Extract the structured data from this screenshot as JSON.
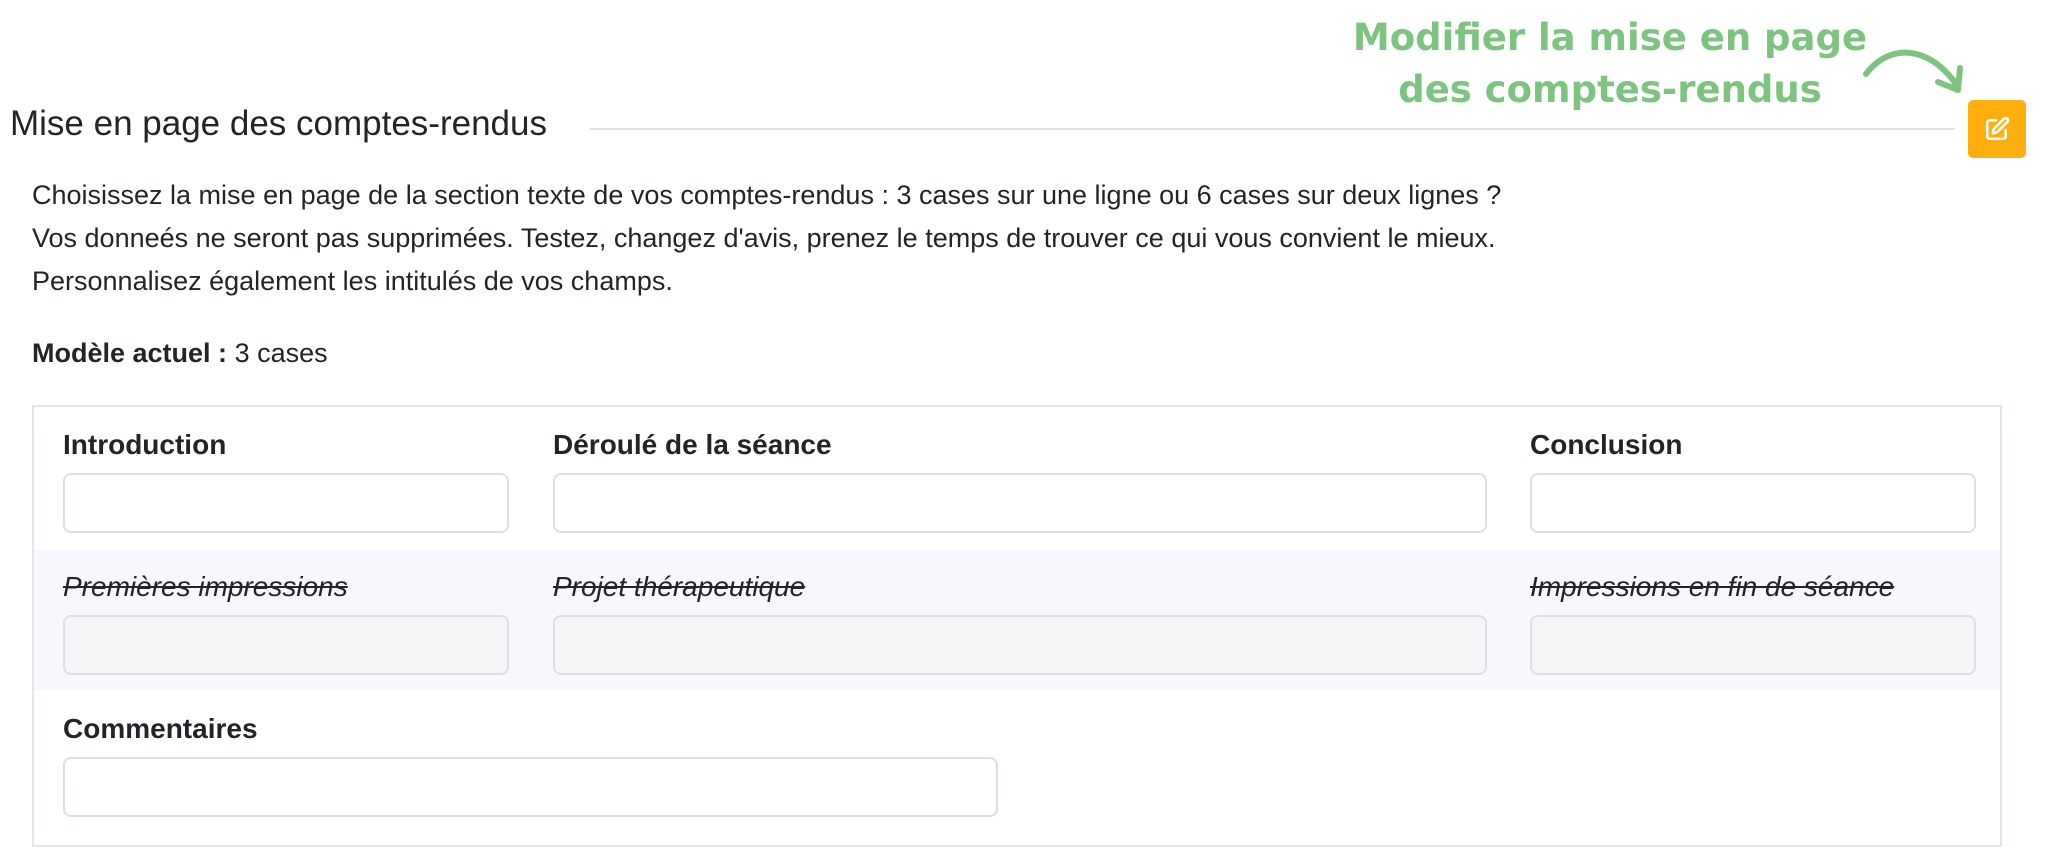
{
  "callout": {
    "line1": "Modifier la mise en page",
    "line2": "des comptes-rendus",
    "color": "#7cc47f"
  },
  "section": {
    "title": "Mise en page des comptes-rendus",
    "edit_icon": "edit-icon",
    "edit_button_color": "#ffae0d"
  },
  "description": {
    "line1": "Choisissez la mise en page de la section texte de vos comptes-rendus : 3 cases sur une ligne ou 6 cases sur deux lignes ?",
    "line2": "Vos donneés ne seront pas supprimées. Testez, changez d'avis, prenez le temps de trouver ce qui vous convient le mieux.",
    "line3": "Personnalisez également les intitulés de vos champs."
  },
  "current_model": {
    "label": "Modèle actuel :",
    "value": "3 cases"
  },
  "layout": {
    "row1": [
      {
        "label": "Introduction",
        "value": ""
      },
      {
        "label": "Déroulé de la séance",
        "value": ""
      },
      {
        "label": "Conclusion",
        "value": ""
      }
    ],
    "row2": [
      {
        "label": "Premières impressions",
        "value": "",
        "disabled": true
      },
      {
        "label": "Projet thérapeutique",
        "value": "",
        "disabled": true
      },
      {
        "label": "Impressions en fin de séance",
        "value": "",
        "disabled": true
      }
    ],
    "comments": {
      "label": "Commentaires",
      "value": ""
    }
  }
}
